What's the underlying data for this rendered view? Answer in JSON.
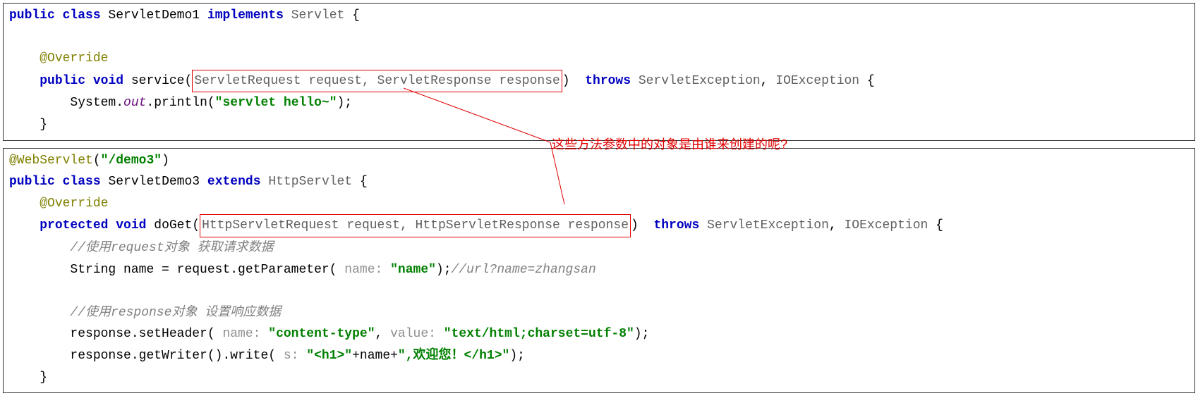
{
  "block1": {
    "line1": {
      "kw_public": "public",
      "kw_class": "class",
      "classname": "ServletDemo1",
      "kw_implements": "implements",
      "iface": "Servlet",
      "brace": " {"
    },
    "line3": {
      "anno": "@Override"
    },
    "line4": {
      "kw_public": "public",
      "kw_void": "void",
      "method": "service",
      "lparen": "(",
      "params": "ServletRequest request, ServletResponse response",
      "rparen": ")",
      "kw_throws": "throws",
      "ex1": "ServletException",
      "comma": ", ",
      "ex2": "IOException",
      "brace": " {"
    },
    "line5": {
      "sys": "System.",
      "out": "out",
      "println": ".println(",
      "str": "\"servlet hello~\"",
      "end": ");"
    },
    "line6": {
      "brace": "}"
    }
  },
  "annotation": {
    "text": "这些方法参数中的对象是由谁来创建的呢?"
  },
  "block2": {
    "line1": {
      "anno": "@WebServlet",
      "lparen": "(",
      "str": "\"/demo3\"",
      "rparen": ")"
    },
    "line2": {
      "kw_public": "public",
      "kw_class": "class",
      "classname": "ServletDemo3",
      "kw_extends": "extends",
      "parent": "HttpServlet",
      "brace": " {"
    },
    "line3": {
      "anno": "@Override"
    },
    "line4": {
      "kw_protected": "protected",
      "kw_void": "void",
      "method": "doGet",
      "lparen": "(",
      "params": "HttpServletRequest request, HttpServletResponse response",
      "rparen": ")",
      "kw_throws": "throws",
      "ex1": "ServletException",
      "comma": ", ",
      "ex2": "IOException",
      "brace": " {"
    },
    "line5": {
      "comment": "//使用request对象 获取请求数据"
    },
    "line6": {
      "decl": "String name = request.getParameter(",
      "hint": " name: ",
      "str": "\"name\"",
      "end": ");",
      "comment": "//url?name=zhangsan"
    },
    "line8": {
      "comment": "//使用response对象 设置响应数据"
    },
    "line9": {
      "call": "response.setHeader(",
      "hint1": " name: ",
      "str1": "\"content-type\"",
      "comma": ", ",
      "hint2": "value: ",
      "str2": "\"text/html;charset=utf-8\"",
      "end": ");"
    },
    "line10": {
      "call": "response.getWriter().write(",
      "hint": " s: ",
      "str1": "\"<h1>\"",
      "plus1": "+name+",
      "str2": "\",欢迎您！</h1>\"",
      "end": ");"
    },
    "line11": {
      "brace": "}"
    }
  }
}
